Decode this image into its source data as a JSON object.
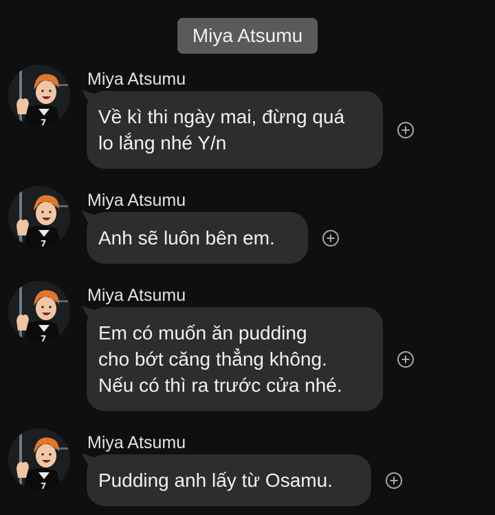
{
  "header": {
    "title": "Miya Atsumu"
  },
  "messages": [
    {
      "sender": "Miya Atsumu",
      "lines": [
        "Về kì thi ngày mai, đừng quá",
        "lo lắng nhé Y/n"
      ]
    },
    {
      "sender": "Miya Atsumu",
      "lines": [
        "Anh sẽ luôn bên em."
      ]
    },
    {
      "sender": "Miya Atsumu",
      "lines": [
        "Em có muốn ăn pudding",
        "cho bớt căng thẳng không.",
        "Nếu có thì ra trước cửa nhé."
      ]
    },
    {
      "sender": "Miya Atsumu",
      "lines": [
        "Pudding anh lấy từ Osamu."
      ]
    }
  ],
  "icons": {
    "avatar": "profile-avatar-icon",
    "react": "add-reaction-icon"
  },
  "colors": {
    "background": "#0f0f10",
    "header": "#5a5a5c",
    "bubble": "#2d2d2f",
    "text": "#f1f1f1",
    "react_icon": "#a9a9a9"
  }
}
